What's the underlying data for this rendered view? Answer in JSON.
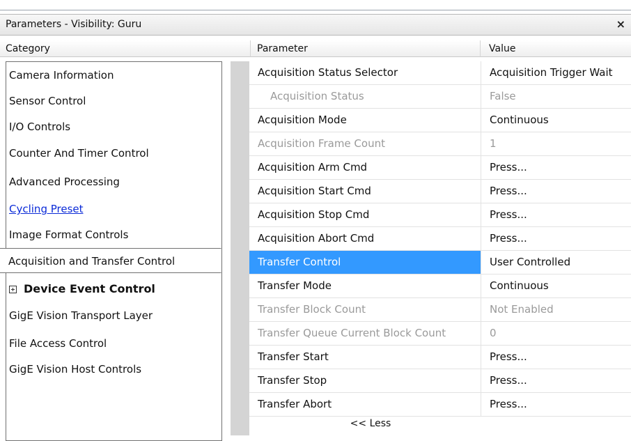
{
  "window": {
    "title": "Parameters - Visibility: Guru",
    "close_label": "×"
  },
  "headers": {
    "category": "Category",
    "parameter": "Parameter",
    "value": "Value"
  },
  "categories": [
    {
      "label": "Camera Information"
    },
    {
      "label": "Sensor Control"
    },
    {
      "label": "I/O Controls"
    },
    {
      "label": "Counter And Timer Control"
    },
    {
      "label": "Advanced Processing"
    },
    {
      "label": "Cycling Preset"
    },
    {
      "label": "Image Format Controls"
    },
    {
      "label": "Acquisition and Transfer Control"
    },
    {
      "label": "Device Event Control"
    },
    {
      "label": "GigE Vision Transport Layer"
    },
    {
      "label": "File Access Control"
    },
    {
      "label": "GigE Vision Host Controls"
    }
  ],
  "selected_category": "Acquisition and Transfer Control",
  "rows": [
    {
      "parameter": "Acquisition Status Selector",
      "value": "Acquisition Trigger Wait"
    },
    {
      "parameter": "Acquisition Status",
      "value": "False"
    },
    {
      "parameter": "Acquisition Mode",
      "value": "Continuous"
    },
    {
      "parameter": "Acquisition Frame Count",
      "value": "1"
    },
    {
      "parameter": "Acquisition Arm Cmd",
      "value": "Press..."
    },
    {
      "parameter": "Acquisition Start Cmd",
      "value": "Press..."
    },
    {
      "parameter": "Acquisition Stop Cmd",
      "value": "Press..."
    },
    {
      "parameter": "Acquisition Abort Cmd",
      "value": "Press..."
    },
    {
      "parameter": "Transfer Control",
      "value": "User Controlled"
    },
    {
      "parameter": "Transfer Mode",
      "value": "Continuous"
    },
    {
      "parameter": "Transfer Block Count",
      "value": "Not Enabled"
    },
    {
      "parameter": "Transfer Queue Current Block Count",
      "value": "0"
    },
    {
      "parameter": "Transfer Start",
      "value": "Press..."
    },
    {
      "parameter": "Transfer Stop",
      "value": "Press..."
    },
    {
      "parameter": "Transfer Abort",
      "value": "Press..."
    }
  ],
  "less_label": "<< Less",
  "colors": {
    "selection": "#3399ff",
    "link": "#0b2bd8",
    "disabled_text": "#9a9a9a"
  }
}
